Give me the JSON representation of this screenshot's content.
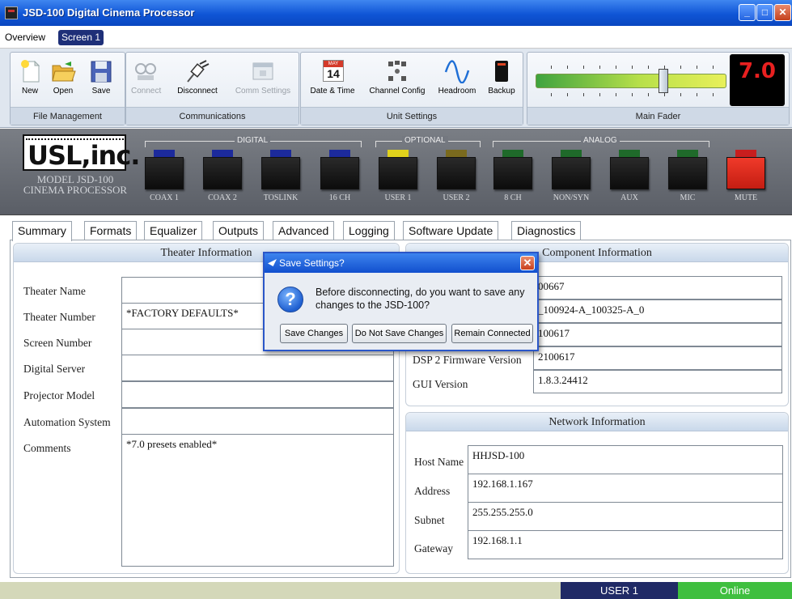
{
  "window": {
    "title": "JSD-100 Digital Cinema Processor"
  },
  "screen_tabs": [
    {
      "label": "Overview"
    },
    {
      "label": "Screen 1"
    }
  ],
  "ribbon": {
    "file_management": {
      "label": "File Management",
      "new": "New",
      "open": "Open",
      "save": "Save"
    },
    "communications": {
      "label": "Communications",
      "connect": "Connect",
      "disconnect": "Disconnect",
      "comm_settings": "Comm Settings"
    },
    "unit_settings": {
      "label": "Unit Settings",
      "date_time": "Date & Time",
      "channel_config": "Channel Config",
      "headroom": "Headroom",
      "backup": "Backup",
      "calendar_month": "MAY",
      "calendar_day": "14"
    },
    "main_fader": {
      "label": "Main Fader",
      "value": "7.0",
      "position": 0.67
    }
  },
  "channel_panel": {
    "logo": "USL,inc.",
    "model_line1": "MODEL JSD-100",
    "model_line2": "CINEMA PROCESSOR",
    "sections": {
      "digital": "DIGITAL",
      "optional": "OPTIONAL",
      "analog": "ANALOG"
    },
    "channels": [
      {
        "label": "COAX 1",
        "led": "#1c2a9c"
      },
      {
        "label": "COAX 2",
        "led": "#1c2a9c"
      },
      {
        "label": "TOSLINK",
        "led": "#1c2a9c"
      },
      {
        "label": "16 CH",
        "led": "#1c2a9c"
      },
      {
        "label": "USER 1",
        "led": "#e0d21c"
      },
      {
        "label": "USER 2",
        "led": "#7a6a1e"
      },
      {
        "label": "8 CH",
        "led": "#1f6a2a"
      },
      {
        "label": "NON/SYN",
        "led": "#1f6a2a"
      },
      {
        "label": "AUX",
        "led": "#1f6a2a"
      },
      {
        "label": "MIC",
        "led": "#1f6a2a"
      },
      {
        "label": "MUTE",
        "led": "#c81e1e"
      }
    ]
  },
  "tabs": [
    {
      "label": "Summary"
    },
    {
      "label": "Formats"
    },
    {
      "label": "Equalizer"
    },
    {
      "label": "Outputs"
    },
    {
      "label": "Advanced"
    },
    {
      "label": "Logging"
    },
    {
      "label": "Software Update"
    },
    {
      "label": "Diagnostics"
    }
  ],
  "theater": {
    "heading": "Theater Information",
    "fields": [
      {
        "label": "Theater Name",
        "value": ""
      },
      {
        "label": "Theater Number",
        "value": "*FACTORY DEFAULTS*"
      },
      {
        "label": "Screen Number",
        "value": ""
      },
      {
        "label": "Digital Server",
        "value": ""
      },
      {
        "label": "Projector Model",
        "value": ""
      },
      {
        "label": "Automation System",
        "value": ""
      },
      {
        "label": "Comments",
        "value": "*7.0 presets enabled*"
      }
    ]
  },
  "component": {
    "heading": "Component Information",
    "fields": [
      {
        "label": "",
        "value": "00667"
      },
      {
        "label": "",
        "value": "_100924-A_100325-A_0"
      },
      {
        "label": "",
        "value": "100617"
      },
      {
        "label": "DSP 2 Firmware Version",
        "value": "2100617"
      },
      {
        "label": "GUI Version",
        "value": "1.8.3.24412"
      }
    ]
  },
  "network": {
    "heading": "Network Information",
    "fields": [
      {
        "label": "Host Name",
        "value": "HHJSD-100"
      },
      {
        "label": "Address",
        "value": "192.168.1.167"
      },
      {
        "label": "Subnet",
        "value": "255.255.255.0"
      },
      {
        "label": "Gateway",
        "value": "192.168.1.1"
      }
    ]
  },
  "dialog": {
    "title": "Save Settings?",
    "message": "Before disconnecting, do you want to save any changes to the JSD-100?",
    "buttons": {
      "save": "Save Changes",
      "dont_save": "Do Not Save Changes",
      "remain": "Remain Connected"
    }
  },
  "status": {
    "preset": "USER 1",
    "connection": "Online"
  }
}
